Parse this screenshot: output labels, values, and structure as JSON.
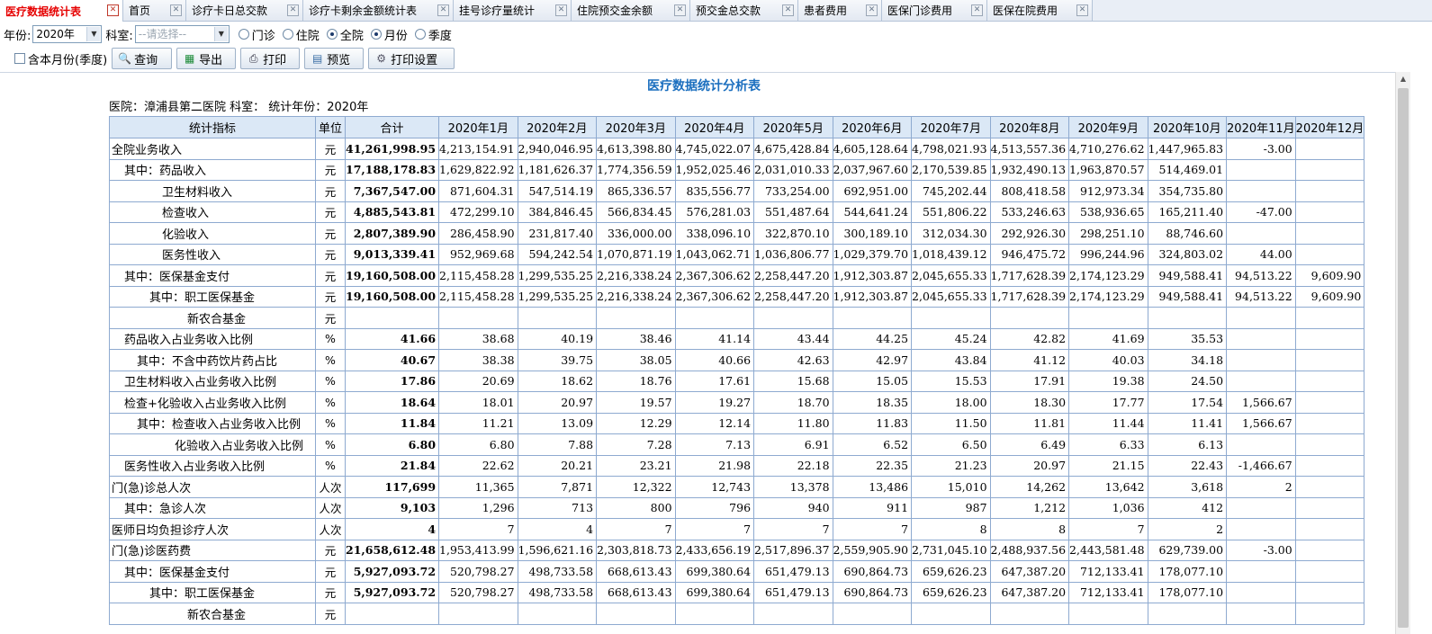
{
  "tabs": [
    {
      "label": "医疗数据统计表",
      "active": true
    },
    {
      "label": "首页"
    },
    {
      "label": "诊疗卡日总交款"
    },
    {
      "label": "诊疗卡剩余金额统计表"
    },
    {
      "label": "挂号诊疗量统计"
    },
    {
      "label": "住院预交金余额"
    },
    {
      "label": "预交金总交款"
    },
    {
      "label": "患者费用"
    },
    {
      "label": "医保门诊费用"
    },
    {
      "label": "医保在院费用"
    }
  ],
  "filters": {
    "year_label": "年份:",
    "year_value": "2020年",
    "dept_label": "科室:",
    "dept_placeholder": "--请选择--",
    "radios": [
      {
        "label": "门诊",
        "checked": false
      },
      {
        "label": "住院",
        "checked": false
      },
      {
        "label": "全院",
        "checked": true
      },
      {
        "label": "月份",
        "checked": true
      },
      {
        "label": "季度",
        "checked": false
      }
    ]
  },
  "toolbar": {
    "checkbox_label": "含本月份(季度)",
    "buttons": [
      {
        "label": "查询",
        "icon": "search-icon"
      },
      {
        "label": "导出",
        "icon": "excel-icon"
      },
      {
        "label": "打印",
        "icon": "printer-icon"
      },
      {
        "label": "预览",
        "icon": "preview-icon"
      },
      {
        "label": "打印设置",
        "icon": "gear-icon"
      }
    ]
  },
  "report": {
    "title": "医疗数据统计分析表",
    "subtitle": "医院：漳浦县第二医院  科室：  统计年份：2020年",
    "columns": [
      "统计指标",
      "单位",
      "合计",
      "2020年1月",
      "2020年2月",
      "2020年3月",
      "2020年4月",
      "2020年5月",
      "2020年6月",
      "2020年7月",
      "2020年8月",
      "2020年9月",
      "2020年10月",
      "2020年11月",
      "2020年12月"
    ],
    "rows": [
      {
        "name": "全院业务收入",
        "indent": 0,
        "unit": "元",
        "total": "41,261,998.95",
        "months": [
          "4,213,154.91",
          "2,940,046.95",
          "4,613,398.80",
          "4,745,022.07",
          "4,675,428.84",
          "4,605,128.64",
          "4,798,021.93",
          "4,513,557.36",
          "4,710,276.62",
          "1,447,965.83",
          "-3.00",
          ""
        ]
      },
      {
        "name": "其中：药品收入",
        "indent": 1,
        "unit": "元",
        "total": "17,188,178.83",
        "months": [
          "1,629,822.92",
          "1,181,626.37",
          "1,774,356.59",
          "1,952,025.46",
          "2,031,010.33",
          "2,037,967.60",
          "2,170,539.85",
          "1,932,490.13",
          "1,963,870.57",
          "514,469.01",
          "",
          ""
        ]
      },
      {
        "name": "卫生材料收入",
        "indent": 4,
        "unit": "元",
        "total": "7,367,547.00",
        "months": [
          "871,604.31",
          "547,514.19",
          "865,336.57",
          "835,556.77",
          "733,254.00",
          "692,951.00",
          "745,202.44",
          "808,418.58",
          "912,973.34",
          "354,735.80",
          "",
          ""
        ]
      },
      {
        "name": "检查收入",
        "indent": 4,
        "unit": "元",
        "total": "4,885,543.81",
        "months": [
          "472,299.10",
          "384,846.45",
          "566,834.45",
          "576,281.03",
          "551,487.64",
          "544,641.24",
          "551,806.22",
          "533,246.63",
          "538,936.65",
          "165,211.40",
          "-47.00",
          ""
        ]
      },
      {
        "name": "化验收入",
        "indent": 4,
        "unit": "元",
        "total": "2,807,389.90",
        "months": [
          "286,458.90",
          "231,817.40",
          "336,000.00",
          "338,096.10",
          "322,870.10",
          "300,189.10",
          "312,034.30",
          "292,926.30",
          "298,251.10",
          "88,746.60",
          "",
          ""
        ]
      },
      {
        "name": "医务性收入",
        "indent": 4,
        "unit": "元",
        "total": "9,013,339.41",
        "months": [
          "952,969.68",
          "594,242.54",
          "1,070,871.19",
          "1,043,062.71",
          "1,036,806.77",
          "1,029,379.70",
          "1,018,439.12",
          "946,475.72",
          "996,244.96",
          "324,803.02",
          "44.00",
          ""
        ]
      },
      {
        "name": "其中：医保基金支付",
        "indent": 1,
        "unit": "元",
        "total": "19,160,508.00",
        "months": [
          "2,115,458.28",
          "1,299,535.25",
          "2,216,338.24",
          "2,367,306.62",
          "2,258,447.20",
          "1,912,303.87",
          "2,045,655.33",
          "1,717,628.39",
          "2,174,123.29",
          "949,588.41",
          "94,513.22",
          "9,609.90"
        ]
      },
      {
        "name": "其中：职工医保基金",
        "indent": 3,
        "unit": "元",
        "total": "19,160,508.00",
        "months": [
          "2,115,458.28",
          "1,299,535.25",
          "2,216,338.24",
          "2,367,306.62",
          "2,258,447.20",
          "1,912,303.87",
          "2,045,655.33",
          "1,717,628.39",
          "2,174,123.29",
          "949,588.41",
          "94,513.22",
          "9,609.90"
        ]
      },
      {
        "name": "新农合基金",
        "indent": 6,
        "unit": "元",
        "total": "",
        "months": [
          "",
          "",
          "",
          "",
          "",
          "",
          "",
          "",
          "",
          "",
          "",
          ""
        ]
      },
      {
        "name": "药品收入占业务收入比例",
        "indent": 1,
        "unit": "%",
        "total": "41.66",
        "months": [
          "38.68",
          "40.19",
          "38.46",
          "41.14",
          "43.44",
          "44.25",
          "45.24",
          "42.82",
          "41.69",
          "35.53",
          "",
          ""
        ]
      },
      {
        "name": "其中：不含中药饮片药占比",
        "indent": 2,
        "unit": "%",
        "total": "40.67",
        "months": [
          "38.38",
          "39.75",
          "38.05",
          "40.66",
          "42.63",
          "42.97",
          "43.84",
          "41.12",
          "40.03",
          "34.18",
          "",
          ""
        ]
      },
      {
        "name": "卫生材料收入占业务收入比例",
        "indent": 1,
        "unit": "%",
        "total": "17.86",
        "months": [
          "20.69",
          "18.62",
          "18.76",
          "17.61",
          "15.68",
          "15.05",
          "15.53",
          "17.91",
          "19.38",
          "24.50",
          "",
          ""
        ]
      },
      {
        "name": "检查+化验收入占业务收入比例",
        "indent": 1,
        "unit": "%",
        "total": "18.64",
        "months": [
          "18.01",
          "20.97",
          "19.57",
          "19.27",
          "18.70",
          "18.35",
          "18.00",
          "18.30",
          "17.77",
          "17.54",
          "1,566.67",
          ""
        ]
      },
      {
        "name": "其中：检查收入占业务收入比例",
        "indent": 2,
        "unit": "%",
        "total": "11.84",
        "months": [
          "11.21",
          "13.09",
          "12.29",
          "12.14",
          "11.80",
          "11.83",
          "11.50",
          "11.81",
          "11.44",
          "11.41",
          "1,566.67",
          ""
        ]
      },
      {
        "name": "化验收入占业务收入比例",
        "indent": 5,
        "unit": "%",
        "total": "6.80",
        "months": [
          "6.80",
          "7.88",
          "7.28",
          "7.13",
          "6.91",
          "6.52",
          "6.50",
          "6.49",
          "6.33",
          "6.13",
          "",
          ""
        ]
      },
      {
        "name": "医务性收入占业务收入比例",
        "indent": 1,
        "unit": "%",
        "total": "21.84",
        "months": [
          "22.62",
          "20.21",
          "23.21",
          "21.98",
          "22.18",
          "22.35",
          "21.23",
          "20.97",
          "21.15",
          "22.43",
          "-1,466.67",
          ""
        ]
      },
      {
        "name": "门(急)诊总人次",
        "indent": 0,
        "unit": "人次",
        "total": "117,699",
        "months": [
          "11,365",
          "7,871",
          "12,322",
          "12,743",
          "13,378",
          "13,486",
          "15,010",
          "14,262",
          "13,642",
          "3,618",
          "2",
          ""
        ]
      },
      {
        "name": "其中：急诊人次",
        "indent": 1,
        "unit": "人次",
        "total": "9,103",
        "months": [
          "1,296",
          "713",
          "800",
          "796",
          "940",
          "911",
          "987",
          "1,212",
          "1,036",
          "412",
          "",
          ""
        ]
      },
      {
        "name": "医师日均负担诊疗人次",
        "indent": 0,
        "unit": "人次",
        "total": "4",
        "months": [
          "7",
          "4",
          "7",
          "7",
          "7",
          "7",
          "8",
          "8",
          "7",
          "2",
          "",
          ""
        ]
      },
      {
        "name": "门(急)诊医药费",
        "indent": 0,
        "unit": "元",
        "total": "21,658,612.48",
        "months": [
          "1,953,413.99",
          "1,596,621.16",
          "2,303,818.73",
          "2,433,656.19",
          "2,517,896.37",
          "2,559,905.90",
          "2,731,045.10",
          "2,488,937.56",
          "2,443,581.48",
          "629,739.00",
          "-3.00",
          ""
        ]
      },
      {
        "name": "其中：医保基金支付",
        "indent": 1,
        "unit": "元",
        "total": "5,927,093.72",
        "months": [
          "520,798.27",
          "498,733.58",
          "668,613.43",
          "699,380.64",
          "651,479.13",
          "690,864.73",
          "659,626.23",
          "647,387.20",
          "712,133.41",
          "178,077.10",
          "",
          ""
        ]
      },
      {
        "name": "其中：职工医保基金",
        "indent": 3,
        "unit": "元",
        "total": "5,927,093.72",
        "months": [
          "520,798.27",
          "498,733.58",
          "668,613.43",
          "699,380.64",
          "651,479.13",
          "690,864.73",
          "659,626.23",
          "647,387.20",
          "712,133.41",
          "178,077.10",
          "",
          ""
        ]
      },
      {
        "name": "新农合基金",
        "indent": 6,
        "unit": "元",
        "total": "",
        "months": [
          "",
          "",
          "",
          "",
          "",
          "",
          "",
          "",
          "",
          "",
          "",
          ""
        ]
      }
    ]
  }
}
